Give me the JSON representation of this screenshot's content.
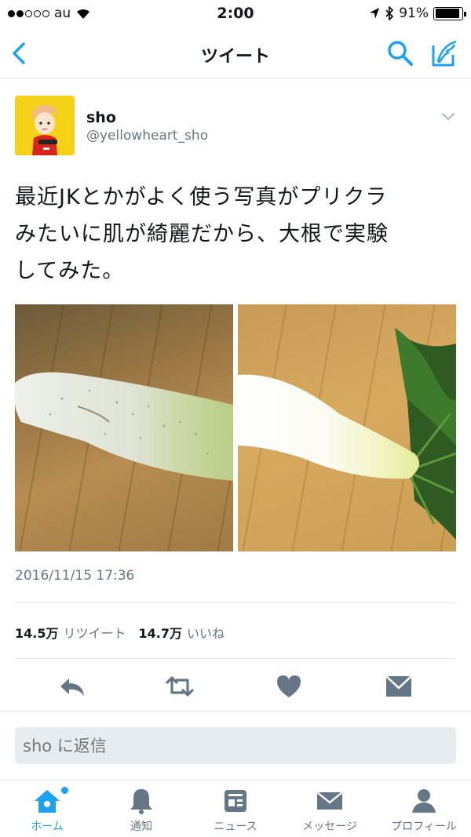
{
  "status_bar": {
    "carrier": "au",
    "time": "2:00",
    "battery_percent": "91%",
    "battery_level": 0.91,
    "signal_bars_filled": 2,
    "signal_bars_total": 5
  },
  "nav": {
    "title": "ツイート",
    "accent": "#1da1f2"
  },
  "tweet": {
    "user_name": "sho",
    "user_handle": "@yellowheart_sho",
    "text_line1": "最近JKとかがよく使う写真がプリクラ",
    "text_line2": "みたいに肌が綺麗だから、大根で実験",
    "text_line3": "してみた。",
    "timestamp": "2016/11/15 17:36",
    "retweet_count": "14.5万",
    "retweet_label": "リツイート",
    "like_count": "14.7万",
    "like_label": "いいね"
  },
  "actions": [
    "reply-icon",
    "retweet-icon",
    "heart-icon",
    "dm-icon"
  ],
  "reply": {
    "placeholder": "sho に返信"
  },
  "tabs": [
    {
      "label": "ホーム",
      "icon": "home-icon",
      "active": true
    },
    {
      "label": "通知",
      "icon": "bell-icon",
      "active": false
    },
    {
      "label": "ニュース",
      "icon": "news-icon",
      "active": false
    },
    {
      "label": "メッセージ",
      "icon": "envelope-icon",
      "active": false
    },
    {
      "label": "プロフィール",
      "icon": "person-icon",
      "active": false
    }
  ],
  "colors": {
    "accent": "#1da1f2",
    "secondary_text": "#657786",
    "icon_gray": "#657786"
  }
}
